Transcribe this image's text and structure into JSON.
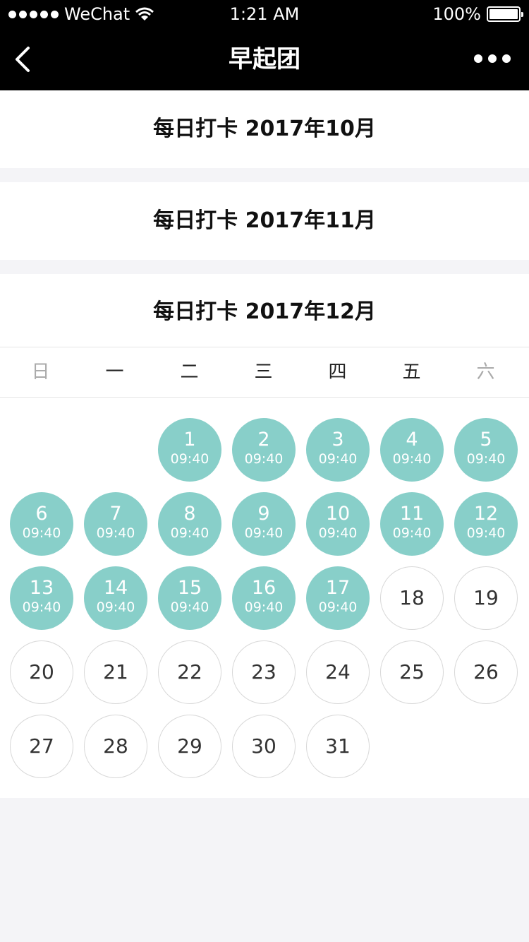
{
  "status_bar": {
    "carrier": "WeChat",
    "time": "1:21 AM",
    "battery": "100%"
  },
  "nav": {
    "title": "早起团"
  },
  "months": [
    {
      "title": "每日打卡 2017年10月"
    },
    {
      "title": "每日打卡 2017年11月"
    },
    {
      "title": "每日打卡 2017年12月"
    }
  ],
  "weekdays": [
    "日",
    "一",
    "二",
    "三",
    "四",
    "五",
    "六"
  ],
  "calendar": {
    "first_weekday_index": 2,
    "days": [
      {
        "day": "1",
        "time": "09:40"
      },
      {
        "day": "2",
        "time": "09:40"
      },
      {
        "day": "3",
        "time": "09:40"
      },
      {
        "day": "4",
        "time": "09:40"
      },
      {
        "day": "5",
        "time": "09:40"
      },
      {
        "day": "6",
        "time": "09:40"
      },
      {
        "day": "7",
        "time": "09:40"
      },
      {
        "day": "8",
        "time": "09:40"
      },
      {
        "day": "9",
        "time": "09:40"
      },
      {
        "day": "10",
        "time": "09:40"
      },
      {
        "day": "11",
        "time": "09:40"
      },
      {
        "day": "12",
        "time": "09:40"
      },
      {
        "day": "13",
        "time": "09:40"
      },
      {
        "day": "14",
        "time": "09:40"
      },
      {
        "day": "15",
        "time": "09:40"
      },
      {
        "day": "16",
        "time": "09:40"
      },
      {
        "day": "17",
        "time": "09:40"
      },
      {
        "day": "18",
        "time": ""
      },
      {
        "day": "19",
        "time": ""
      },
      {
        "day": "20",
        "time": ""
      },
      {
        "day": "21",
        "time": ""
      },
      {
        "day": "22",
        "time": ""
      },
      {
        "day": "23",
        "time": ""
      },
      {
        "day": "24",
        "time": ""
      },
      {
        "day": "25",
        "time": ""
      },
      {
        "day": "26",
        "time": ""
      },
      {
        "day": "27",
        "time": ""
      },
      {
        "day": "28",
        "time": ""
      },
      {
        "day": "29",
        "time": ""
      },
      {
        "day": "30",
        "time": ""
      },
      {
        "day": "31",
        "time": ""
      }
    ]
  },
  "colors": {
    "checked": "#88cfc9",
    "nav_background": "#000000",
    "page_background": "#f4f4f7"
  }
}
